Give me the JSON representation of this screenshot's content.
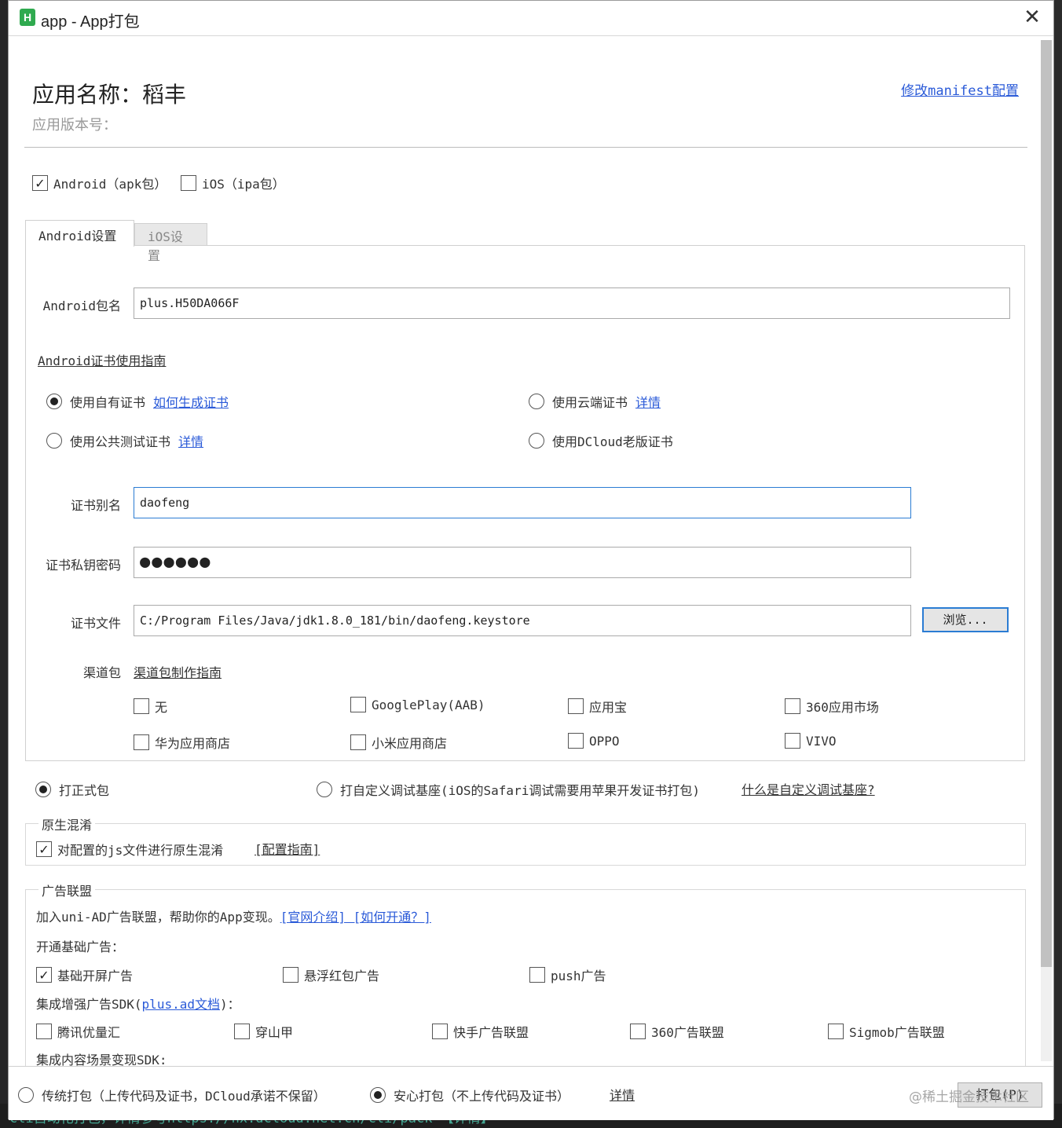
{
  "window": {
    "logo": "H",
    "title": "app - App打包",
    "close": "✕"
  },
  "header": {
    "app_name": "应用名称：稻丰",
    "app_version": "应用版本号：",
    "manifest_link": "修改manifest配置"
  },
  "platforms": {
    "android": {
      "label": "Android（apk包）",
      "checked": true
    },
    "ios": {
      "label": "iOS（ipa包）",
      "checked": false
    }
  },
  "tabs": [
    {
      "label": "Android设置",
      "active": true
    },
    {
      "label": "iOS设置",
      "active": false
    }
  ],
  "android": {
    "package_label": "Android包名",
    "package_value": "plus.H50DA066F",
    "cert_guide_link": "Android证书使用指南",
    "cert_options": {
      "own": {
        "label": "使用自有证书",
        "link": "如何生成证书",
        "selected": true
      },
      "cloud": {
        "label": "使用云端证书",
        "link": "详情",
        "selected": false
      },
      "public_test": {
        "label": "使用公共测试证书",
        "link": "详情",
        "selected": false
      },
      "dcloud_old": {
        "label": "使用DCloud老版证书",
        "selected": false
      }
    },
    "alias_label": "证书别名",
    "alias_value": "daofeng",
    "password_label": "证书私钥密码",
    "password_value": "●●●●●●",
    "file_label": "证书文件",
    "file_value": "C:/Program Files/Java/jdk1.8.0_181/bin/daofeng.keystore",
    "browse_label": "浏览...",
    "channel_label": "渠道包",
    "channel_guide_link": "渠道包制作指南",
    "channels": [
      "无",
      "GooglePlay(AAB)",
      "应用宝",
      "360应用市场",
      "华为应用商店",
      "小米应用商店",
      "OPPO",
      "VIVO"
    ]
  },
  "build_type": {
    "formal": {
      "label": "打正式包",
      "selected": true
    },
    "custom_debug": {
      "label": "打自定义调试基座(iOS的Safari调试需要用苹果开发证书打包)",
      "selected": false
    },
    "custom_debug_link": "什么是自定义调试基座?"
  },
  "obfuscation": {
    "title": "原生混淆",
    "checkbox_label": "对配置的js文件进行原生混淆",
    "checked": true,
    "guide_link": "[配置指南]"
  },
  "ads": {
    "title": "广告联盟",
    "intro": "加入uni-AD广告联盟，帮助你的App变现。",
    "intro_links": "[官网介绍] [如何开通？]",
    "basic_title": "开通基础广告：",
    "basic": [
      {
        "label": "基础开屏广告",
        "checked": true
      },
      {
        "label": "悬浮红包广告",
        "checked": false
      },
      {
        "label": "push广告",
        "checked": false
      }
    ],
    "enhanced_prefix": "集成增强广告SDK(",
    "enhanced_link": "plus.ad文档",
    "enhanced_suffix": ")：",
    "enhanced": [
      "腾讯优量汇",
      "穿山甲",
      "快手广告联盟",
      "360广告联盟",
      "Sigmob广告联盟"
    ],
    "content_title": "集成内容场景变现SDK:"
  },
  "footer": {
    "traditional": {
      "label": "传统打包（上传代码及证书，DCloud承诺不保留）",
      "selected": false
    },
    "safe": {
      "label": "安心打包（不上传代码及证书）",
      "selected": true
    },
    "details_link": "详情",
    "pack_button": "打包(P)",
    "watermark": "@稀土掘金技术社区"
  },
  "background_code": "cli自动化打包，详情参考https://hx.dcloud.net.cn/cli/pack 【详情】"
}
